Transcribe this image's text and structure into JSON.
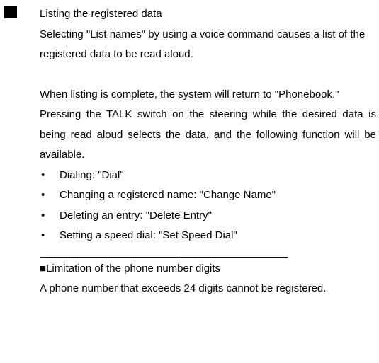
{
  "section": {
    "heading": "Listing the registered data",
    "intro": "Selecting \"List names\" by using a voice command causes a list of the registered data to be read aloud.",
    "after_listing": "When listing is complete, the system will return to \"Phonebook.\"",
    "talk_switch": "Pressing the TALK switch on the steering while the desired data is being read aloud selects the data, and the following function will be available.",
    "bullets": [
      "Dialing: \"Dial\"",
      "Changing a registered name: \"Change Name\"",
      "Deleting an entry: \"Delete Entry\"",
      "Setting a speed dial: \"Set Speed Dial\""
    ],
    "divider": "__________________________________________",
    "limitation_marker": "■",
    "limitation_heading": "Limitation of the phone number digits",
    "limitation_body": "A phone number that exceeds 24 digits cannot be registered."
  }
}
